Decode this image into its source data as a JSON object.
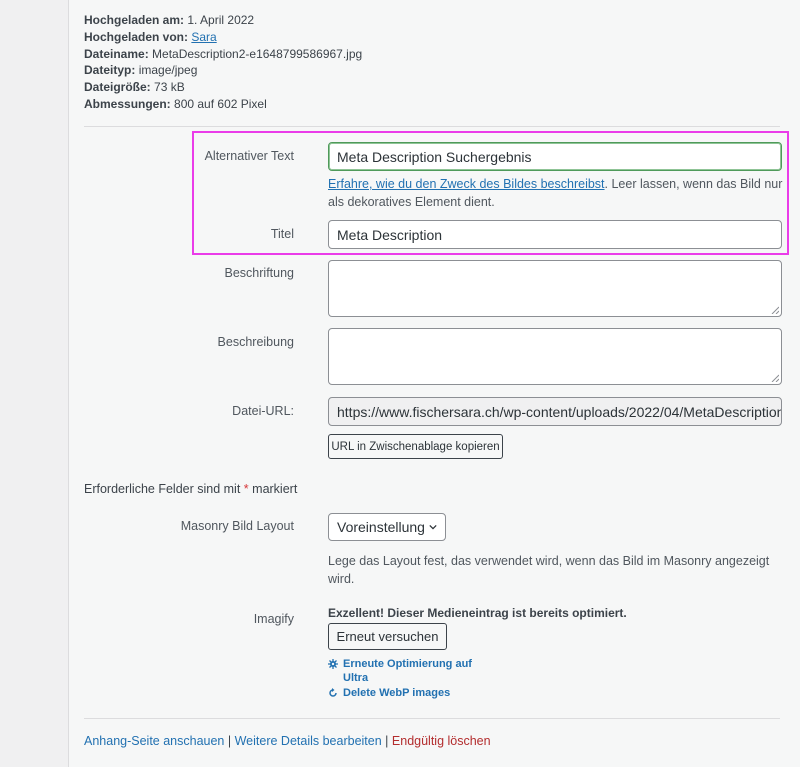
{
  "file_info": {
    "uploaded_on_label": "Hochgeladen am:",
    "uploaded_on_value": "1. April 2022",
    "uploaded_by_label": "Hochgeladen von:",
    "uploaded_by_value": "Sara",
    "filename_label": "Dateiname:",
    "filename_value": "MetaDescription2-e1648799586967.jpg",
    "filetype_label": "Dateityp:",
    "filetype_value": "image/jpeg",
    "filesize_label": "Dateigröße:",
    "filesize_value": "73 kB",
    "dimensions_label": "Abmessungen:",
    "dimensions_value": "800 auf 602 Pixel"
  },
  "form": {
    "alt_label": "Alternativer Text",
    "alt_value": "Meta Description Suchergebnis",
    "alt_help_link": "Erfahre, wie du den Zweck des Bildes beschreibst",
    "alt_help_text": ". Leer lassen, wenn das Bild nur als dekoratives Element dient.",
    "title_label": "Titel",
    "title_value": "Meta Description",
    "caption_label": "Beschriftung",
    "description_label": "Beschreibung",
    "url_label": "Datei-URL:",
    "url_value": "https://www.fischersara.ch/wp-content/uploads/2022/04/MetaDescription",
    "copy_button": "URL in Zwischenablage kopieren",
    "required_text": "Erforderliche Felder sind mit",
    "required_star": "*",
    "required_suffix": "markiert",
    "masonry_label": "Masonry Bild Layout",
    "masonry_value": "Voreinstellung",
    "masonry_help": "Lege das Layout fest, das verwendet wird, wenn das Bild im Masonry angezeigt wird.",
    "imagify_label": "Imagify",
    "imagify_status": "Exzellent! Dieser Medieneintrag ist bereits optimiert.",
    "imagify_retry": "Erneut versuchen",
    "imagify_reoptimize": "Erneute Optimierung auf Ultra",
    "imagify_delete_webp": "Delete WebP images"
  },
  "actions": {
    "view_attachment": "Anhang-Seite anschauen",
    "edit_details": "Weitere Details bearbeiten",
    "delete_permanently": "Endgültig löschen",
    "separator": "|"
  },
  "colors": {
    "link": "#2271b1",
    "danger": "#b32d2e",
    "highlight": "#ea3ce9",
    "focus": "#4f9a5a"
  },
  "icons": {
    "reoptimize": "gear-icon",
    "delete_webp": "refresh-icon",
    "select": "chevron-down-icon"
  }
}
